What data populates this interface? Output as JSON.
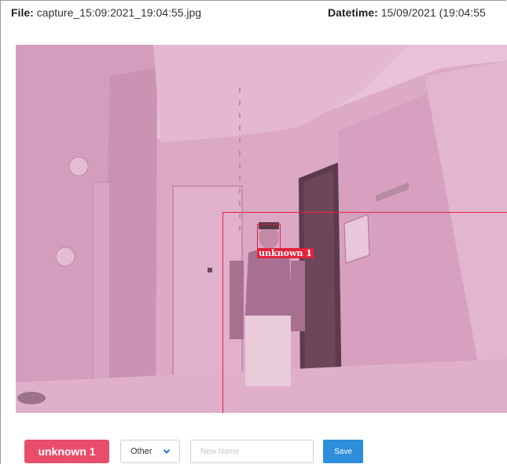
{
  "meta": {
    "file_label": "File:",
    "file_value": "capture_15:09:2021_19:04:55.jpg",
    "datetime_label": "Datetime:",
    "datetime_value": "15/09/2021 (19:04:55"
  },
  "detection": {
    "label": "unknown 1",
    "box_color": "#e2243b"
  },
  "controls": {
    "name_badge": "unknown 1",
    "category_select": "Other",
    "new_name_placeholder": "New Name",
    "new_name_value": "",
    "save_label": "Save"
  },
  "colors": {
    "badge": "#e84d6b",
    "save_button": "#2d8fd9",
    "camera_tint": "#d8a6c2"
  }
}
